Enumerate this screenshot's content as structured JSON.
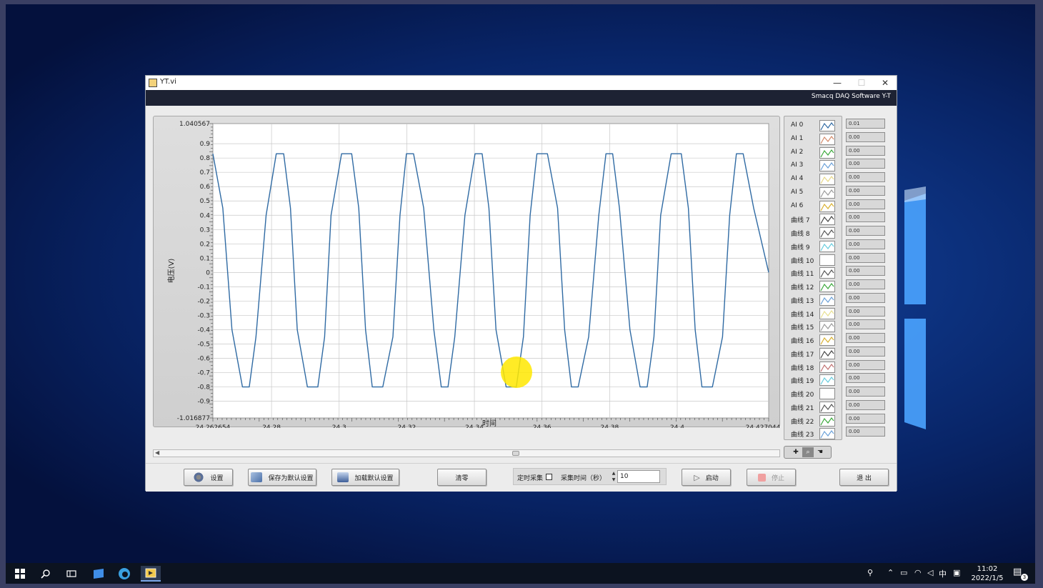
{
  "window": {
    "title": "YT.vi",
    "banner": "Smacq DAQ Software Y-T",
    "controls": {
      "minimize": "—",
      "maximize": "☐",
      "close": "✕"
    }
  },
  "chart_data": {
    "type": "line",
    "title": "",
    "xlabel": "时间",
    "ylabel": "电压(V)",
    "xlim": [
      24.262654,
      24.427044
    ],
    "ylim": [
      -1.016877,
      1.040567
    ],
    "x_tick_labels": [
      "24.262654",
      "24.28",
      "24.3",
      "24.32",
      "24.34",
      "24.36",
      "24.38",
      "24.4",
      "24.427044"
    ],
    "y_tick_labels": [
      "1.040567",
      "0.9",
      "0.8",
      "0.7",
      "0.6",
      "0.5",
      "0.4",
      "0.3",
      "0.2",
      "0.1",
      "0",
      "-0.1",
      "-0.2",
      "-0.3",
      "-0.4",
      "-0.5",
      "-0.6",
      "-0.7",
      "-0.8",
      "-0.9",
      "-1.016877"
    ],
    "grid": true,
    "series": [
      {
        "name": "AI 0",
        "color": "#2f6aa3",
        "x": [
          24.262654,
          24.2656,
          24.2683,
          24.2714,
          24.2734,
          24.2754,
          24.2784,
          24.2814,
          24.2836,
          24.2856,
          24.2876,
          24.2906,
          24.2937,
          24.2957,
          24.2976,
          24.3007,
          24.3037,
          24.3058,
          24.3078,
          24.3098,
          24.3129,
          24.3159,
          24.318,
          24.3199,
          24.322,
          24.325,
          24.328,
          24.3302,
          24.3322,
          24.3342,
          24.3372,
          24.3402,
          24.3423,
          24.3443,
          24.3464,
          24.3494,
          24.3524,
          24.3545,
          24.3565,
          24.3585,
          24.3616,
          24.3646,
          24.3667,
          24.3687,
          24.3707,
          24.3738,
          24.3768,
          24.3789,
          24.3809,
          24.3829,
          24.386,
          24.389,
          24.3911,
          24.3931,
          24.3951,
          24.3982,
          24.4012,
          24.4033,
          24.4053,
          24.4073,
          24.4104,
          24.4134,
          24.4155,
          24.4175,
          24.4195,
          24.4226,
          24.427044
        ],
        "y": [
          0.83,
          0.45,
          -0.4,
          -0.8,
          -0.8,
          -0.45,
          0.4,
          0.83,
          0.83,
          0.45,
          -0.4,
          -0.8,
          -0.8,
          -0.45,
          0.4,
          0.83,
          0.83,
          0.45,
          -0.4,
          -0.8,
          -0.8,
          -0.45,
          0.4,
          0.83,
          0.83,
          0.45,
          -0.4,
          -0.8,
          -0.8,
          -0.45,
          0.4,
          0.83,
          0.83,
          0.45,
          -0.4,
          -0.8,
          -0.8,
          -0.45,
          0.4,
          0.83,
          0.83,
          0.45,
          -0.4,
          -0.8,
          -0.8,
          -0.45,
          0.4,
          0.83,
          0.83,
          0.45,
          -0.4,
          -0.8,
          -0.8,
          -0.45,
          0.4,
          0.83,
          0.83,
          0.45,
          -0.4,
          -0.8,
          -0.8,
          -0.45,
          0.4,
          0.83,
          0.83,
          0.45,
          0.0
        ]
      }
    ]
  },
  "legend": [
    {
      "label": "AI 0",
      "color": "#2f6aa3",
      "value": "0.01"
    },
    {
      "label": "AI 1",
      "color": "#d48a6a",
      "value": "0.00"
    },
    {
      "label": "AI 2",
      "color": "#3aa83a",
      "value": "0.00"
    },
    {
      "label": "AI 3",
      "color": "#6aa0d8",
      "value": "0.00"
    },
    {
      "label": "AI 4",
      "color": "#e8d888",
      "value": "0.00"
    },
    {
      "label": "AI 5",
      "color": "#9a9a9a",
      "value": "0.00"
    },
    {
      "label": "AI 6",
      "color": "#d8b030",
      "value": "0.00"
    },
    {
      "label": "曲线 7",
      "color": "#444444",
      "value": "0.00"
    },
    {
      "label": "曲线 8",
      "color": "#555555",
      "value": "0.00"
    },
    {
      "label": "曲线 9",
      "color": "#66ccdd",
      "value": "0.00"
    },
    {
      "label": "曲线 10",
      "color": "#ffffff",
      "value": "0.00"
    },
    {
      "label": "曲线 11",
      "color": "#555555",
      "value": "0.00"
    },
    {
      "label": "曲线 12",
      "color": "#3aa83a",
      "value": "0.00"
    },
    {
      "label": "曲线 13",
      "color": "#6aa0d8",
      "value": "0.00"
    },
    {
      "label": "曲线 14",
      "color": "#e8e090",
      "value": "0.00"
    },
    {
      "label": "曲线 15",
      "color": "#9a9a9a",
      "value": "0.00"
    },
    {
      "label": "曲线 16",
      "color": "#d8b030",
      "value": "0.00"
    },
    {
      "label": "曲线 17",
      "color": "#444444",
      "value": "0.00"
    },
    {
      "label": "曲线 18",
      "color": "#c07070",
      "value": "0.00"
    },
    {
      "label": "曲线 19",
      "color": "#66ccdd",
      "value": "0.00"
    },
    {
      "label": "曲线 20",
      "color": "#ffffff",
      "value": "0.00"
    },
    {
      "label": "曲线 21",
      "color": "#555555",
      "value": "0.00"
    },
    {
      "label": "曲线 22",
      "color": "#3aa83a",
      "value": "0.00"
    },
    {
      "label": "曲线 23",
      "color": "#6aa0d8",
      "value": "0.00"
    }
  ],
  "palette": {
    "zoom": "✚",
    "pan": "⌕",
    "hand": "☚"
  },
  "buttons": {
    "settings": "设置",
    "save_default": "保存为默认设置",
    "load_default": "加载默认设置",
    "clear": "清零",
    "timed_acq": "定时采集",
    "acq_time_label": "采集时间（秒）",
    "acq_time_value": "10",
    "start": "启动",
    "stop": "停止",
    "exit": "退 出"
  },
  "taskbar": {
    "time": "11:02",
    "date": "2022/1/5",
    "ime": "中",
    "notification_count": "3"
  }
}
